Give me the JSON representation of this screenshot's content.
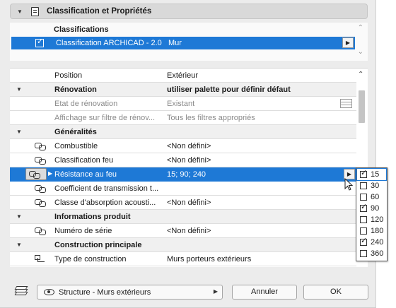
{
  "section": {
    "title": "Classification et Propriétés"
  },
  "classifications": {
    "header": "Classifications",
    "row": {
      "checked": true,
      "label": "Classification ARCHICAD - 2.0",
      "value": "Mur"
    }
  },
  "properties": [
    {
      "kind": "plain",
      "label": "Position",
      "value": "Extérieur"
    },
    {
      "kind": "group",
      "label": "Rénovation",
      "value": "utiliser palette pour définir défaut"
    },
    {
      "kind": "dim",
      "label": "Etat de rénovation",
      "value": "Existant",
      "icon": "grid-icon"
    },
    {
      "kind": "dim",
      "label": "Affichage sur filtre de rénov...",
      "value": "Tous les filtres appropriés"
    },
    {
      "kind": "group",
      "label": "Généralités",
      "value": ""
    },
    {
      "kind": "item",
      "icon": "link-icon",
      "label": "Combustible",
      "value": "<Non défini>"
    },
    {
      "kind": "item",
      "icon": "link-icon",
      "label": "Classification feu",
      "value": "<Non défini>"
    },
    {
      "kind": "selected",
      "icon": "link-icon",
      "label": "Résistance au feu",
      "value": "15; 90; 240"
    },
    {
      "kind": "item",
      "icon": "link-icon",
      "label": "Coefficient de transmission t...",
      "value": ""
    },
    {
      "kind": "item",
      "icon": "link-icon",
      "label": "Classe d'absorption acousti...",
      "value": "<Non défini>"
    },
    {
      "kind": "group",
      "label": "Informations produit",
      "value": ""
    },
    {
      "kind": "item",
      "icon": "link-icon",
      "label": "Numéro de série",
      "value": "<Non défini>"
    },
    {
      "kind": "group",
      "label": "Construction principale",
      "value": ""
    },
    {
      "kind": "item",
      "icon": "flow-icon",
      "label": "Type de construction",
      "value": "Murs porteurs extérieurs"
    }
  ],
  "fire_options": [
    {
      "label": "15",
      "checked": true
    },
    {
      "label": "30",
      "checked": false
    },
    {
      "label": "60",
      "checked": false
    },
    {
      "label": "90",
      "checked": true
    },
    {
      "label": "120",
      "checked": false
    },
    {
      "label": "180",
      "checked": false
    },
    {
      "label": "240",
      "checked": true
    },
    {
      "label": "360",
      "checked": false
    }
  ],
  "footer": {
    "structure_label": "Structure - Murs extérieurs",
    "cancel_label": "Annuler",
    "ok_label": "OK"
  },
  "colors": {
    "selection": "#1e79d6"
  }
}
